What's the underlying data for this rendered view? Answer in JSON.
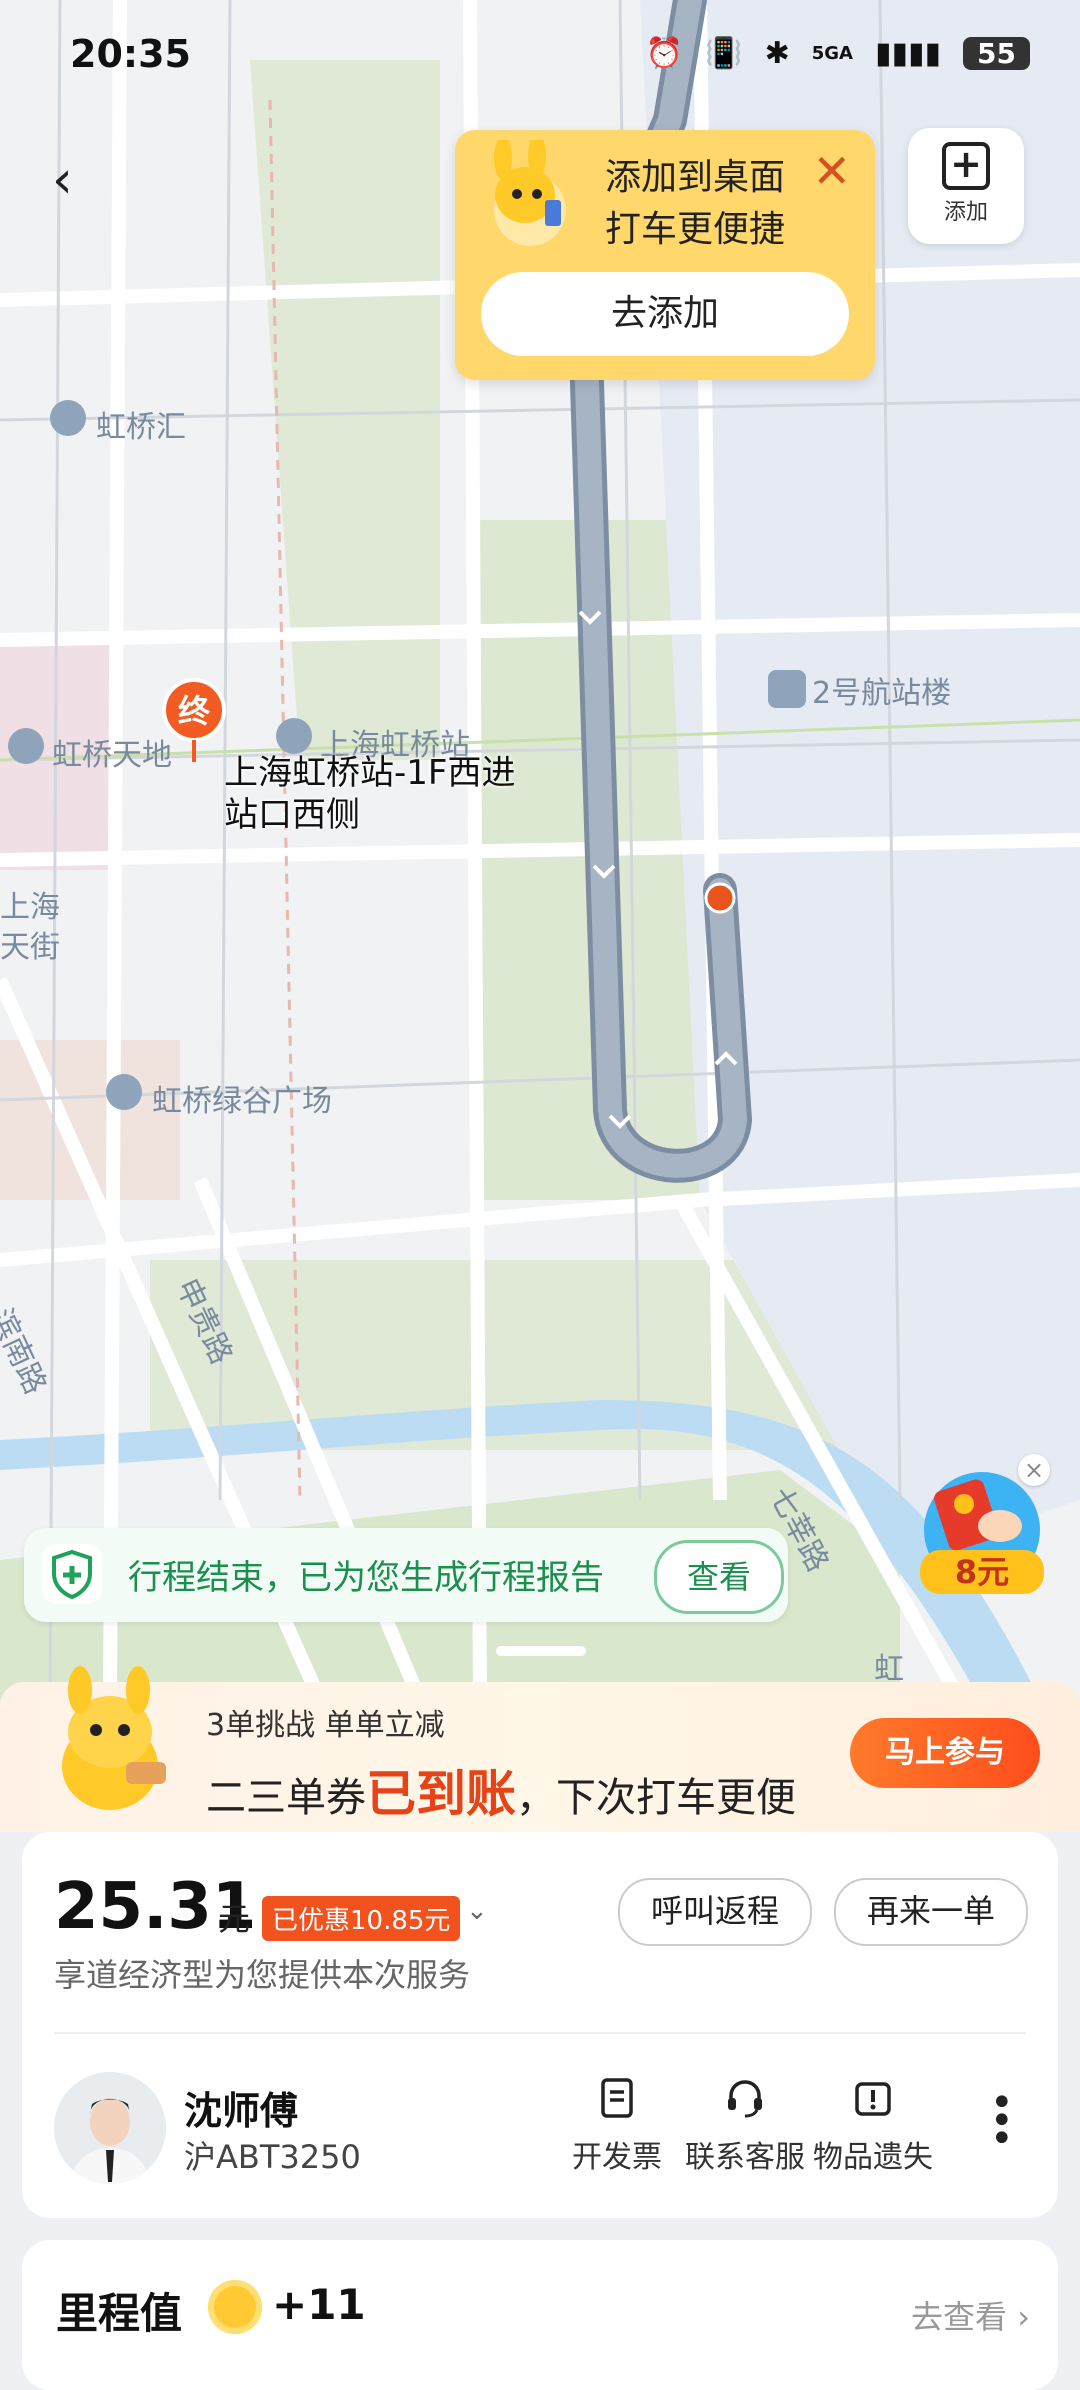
{
  "status_bar": {
    "time": "20:35",
    "network": "5GA",
    "battery": "55"
  },
  "map": {
    "labels": {
      "hongqiao_hui": "虹桥汇",
      "hongqiao_tiandi": "虹桥天地",
      "shanghai_hongqiao_station": "上海虹桥站",
      "terminal2": "2号航站楼",
      "shanghai_street_line1": "上海",
      "shanghai_street_line2": "天街",
      "hongqiao_lvgu": "虹桥绿谷广场",
      "shengui_road": "申贵路",
      "binhai_south_road": "滨南路",
      "qixin_road": "七莘路",
      "road_fragment": "虹"
    },
    "destination_badge": "终",
    "destination_name_line1": "上海虹桥站-1F西进",
    "destination_name_line2": "站口西侧"
  },
  "add_button": {
    "label": "添加"
  },
  "shortcut_tip": {
    "line1": "添加到桌面",
    "line2": "打车更便捷",
    "button": "去添加",
    "close": "✕"
  },
  "trip_report": {
    "text": "行程结束，已为您生成行程报告",
    "button": "查看"
  },
  "red_packet": {
    "amount": "8元"
  },
  "promo": {
    "line1": "3单挑战 单单立减",
    "line2_prefix": "二三单券",
    "line2_highlight": "已到账",
    "line2_suffix": "，下次打车更便",
    "join_button": "马上参与"
  },
  "fare": {
    "amount": "25.31",
    "unit": "元",
    "discount": "已优惠10.85元",
    "service": "享道经济型为您提供本次服务",
    "return_button": "呼叫返程",
    "again_button": "再来一单"
  },
  "driver": {
    "name": "沈师傅",
    "plate": "沪ABT3250"
  },
  "actions": {
    "invoice": "开发票",
    "support": "联系客服",
    "lost": "物品遗失"
  },
  "mileage": {
    "title": "里程值",
    "value": "+11",
    "link": "去查看"
  },
  "colors": {
    "route": "#9aa8b8",
    "accent_orange": "#f2521e",
    "green": "#1a8f4e",
    "tip_yellow": "#ffd76b"
  }
}
